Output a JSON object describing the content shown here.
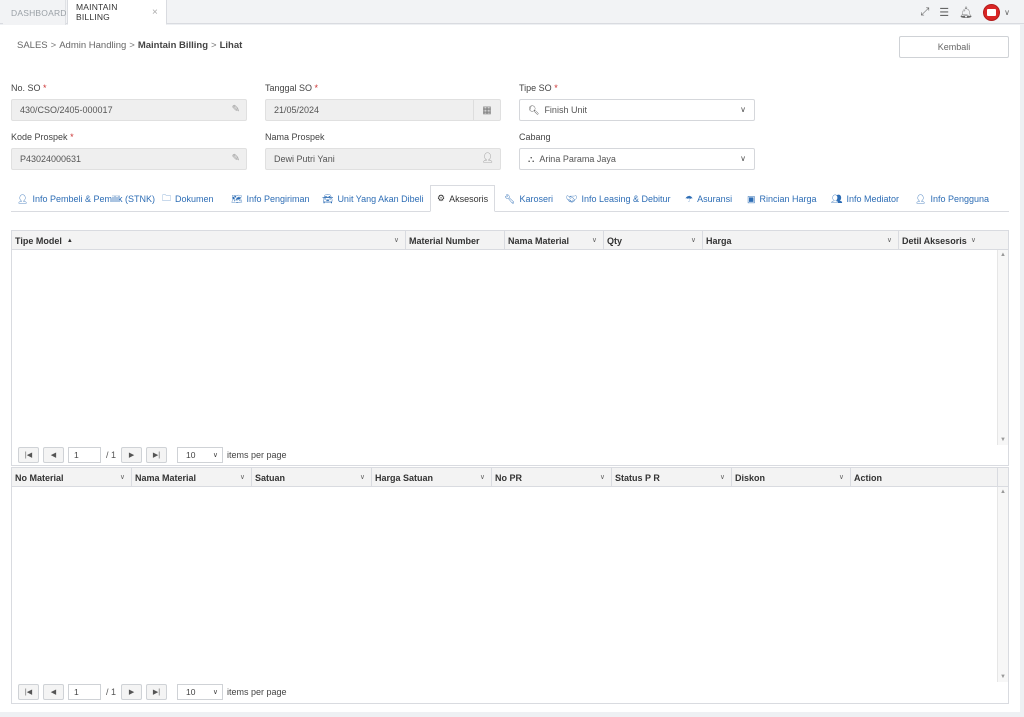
{
  "top_tabs": [
    {
      "label": "DASHBOARD"
    },
    {
      "label": "MAINTAIN BILLING",
      "close": "×"
    }
  ],
  "icons": {
    "fullscreen": "expand-icon",
    "menu": "hamburger-icon",
    "notifications": "bell-icon",
    "user": "user-avatar",
    "dropdown": "chevron-down-icon"
  },
  "breadcrumb": {
    "items": [
      "SALES",
      "Admin Handling",
      "Maintain Billing",
      "Lihat"
    ],
    "separator": ">"
  },
  "back_button": "Kembali",
  "form": {
    "no_so": {
      "label": "No. SO",
      "required": "*",
      "value": "430/CSO/2405-000017"
    },
    "tanggal_so": {
      "label": "Tanggal SO",
      "required": "*",
      "value": "21/05/2024"
    },
    "tipe_so": {
      "label": "Tipe SO",
      "required": "*",
      "value": "Finish Unit"
    },
    "kode_prospek": {
      "label": "Kode Prospek",
      "required": "*",
      "value": "P43024000631"
    },
    "nama_prospek": {
      "label": "Nama Prospek",
      "value": "Dewi Putri Yani"
    },
    "cabang": {
      "label": "Cabang",
      "value": "Arina Parama Jaya"
    }
  },
  "section_tabs": [
    {
      "label": "Info Pembeli & Pemilik (STNK)",
      "icon": "user-icon"
    },
    {
      "label": "Dokumen",
      "icon": "folder-icon"
    },
    {
      "label": "Info Pengiriman",
      "icon": "map-icon"
    },
    {
      "label": "Unit Yang Akan Dibeli",
      "icon": "car-icon"
    },
    {
      "label": "Aksesoris",
      "icon": "cogs-icon",
      "active": true
    },
    {
      "label": "Karoseri",
      "icon": "wrench-icon"
    },
    {
      "label": "Info Leasing & Debitur",
      "icon": "handshake-icon"
    },
    {
      "label": "Asuransi",
      "icon": "umbrella-icon"
    },
    {
      "label": "Rincian Harga",
      "icon": "money-icon"
    },
    {
      "label": "Info Mediator",
      "icon": "users-icon"
    },
    {
      "label": "Info Pengguna",
      "icon": "user-icon"
    }
  ],
  "grid1": {
    "columns": [
      "Tipe Model",
      "Material Number",
      "Nama Material",
      "Qty",
      "Harga",
      "Detil Aksesoris"
    ],
    "rows": [],
    "pager": {
      "page": "1",
      "of": "/ 1",
      "per_page": "10",
      "per_page_label": "items per page"
    }
  },
  "grid2": {
    "columns": [
      "No Material",
      "Nama Material",
      "Satuan",
      "Harga Satuan",
      "No PR",
      "Status P R",
      "Diskon",
      "Action"
    ],
    "rows": [],
    "pager": {
      "page": "1",
      "of": "/ 1",
      "per_page": "10",
      "per_page_label": "items per page"
    }
  }
}
